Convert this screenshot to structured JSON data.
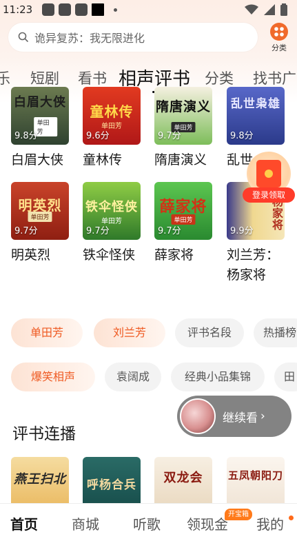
{
  "status_bar": {
    "time": "11:23"
  },
  "search": {
    "placeholder": "诡异复苏：我无限进化"
  },
  "category_button": {
    "label": "分类"
  },
  "tabs": [
    {
      "label": "乐"
    },
    {
      "label": "短剧"
    },
    {
      "label": "看书"
    },
    {
      "label": "相声评书",
      "active": true
    },
    {
      "label": "分类"
    },
    {
      "label": "找书广"
    }
  ],
  "books_row1": [
    {
      "cover_title": "白眉大侠",
      "author": "单田芳",
      "score": "9.8分",
      "name": "白眉大侠"
    },
    {
      "cover_title": "童林传",
      "author": "单田芳",
      "score": "9.6分",
      "name": "童林传"
    },
    {
      "cover_title": "隋唐演义",
      "author": "单田芳",
      "score": "9.7分",
      "name": "隋唐演义"
    },
    {
      "cover_title": "乱世枭雄",
      "author": "",
      "score": "9.8分",
      "name": "乱世"
    }
  ],
  "books_row2": [
    {
      "cover_title": "明英烈",
      "author": "单田芳",
      "score": "9.7分",
      "name": "明英烈"
    },
    {
      "cover_title": "铁伞怪侠",
      "author": "单田芳",
      "score": "9.7分",
      "name": "铁伞怪侠"
    },
    {
      "cover_title": "薛家将",
      "author": "单田芳",
      "score": "9.7分",
      "name": "薛家将"
    },
    {
      "cover_title": "杨家将",
      "author": "",
      "score": "9.9分",
      "name": "刘兰芳：杨家将"
    }
  ],
  "redpacket": {
    "label": "登录领取"
  },
  "chips_row1": [
    {
      "label": "单田芳",
      "hot": true
    },
    {
      "label": "刘兰芳",
      "hot": true
    },
    {
      "label": "评书名段",
      "hot": false
    },
    {
      "label": "热播榜",
      "hot": false
    }
  ],
  "chips_row2": [
    {
      "label": "爆笑相声",
      "hot": true
    },
    {
      "label": "袁阔成",
      "hot": false
    },
    {
      "label": "经典小品集锦",
      "hot": false
    },
    {
      "label": "田",
      "hot": false
    }
  ],
  "section": {
    "title": "评书连播"
  },
  "continue": {
    "label": "继续看",
    "chevron": "›"
  },
  "bottom_books": [
    {
      "cover_title": "燕王扫北"
    },
    {
      "cover_title": "呼杨合兵"
    },
    {
      "cover_title": "双龙会"
    },
    {
      "cover_title": "五凤朝阳刀"
    }
  ],
  "bottom_nav": [
    {
      "label": "首页",
      "active": true
    },
    {
      "label": "商城"
    },
    {
      "label": "听歌"
    },
    {
      "label": "领现金"
    },
    {
      "label": "我的"
    }
  ],
  "nav_badge": "开宝箱",
  "colors": {
    "accent": "#f06a2b",
    "hot_chip_text": "#ef5a22"
  }
}
